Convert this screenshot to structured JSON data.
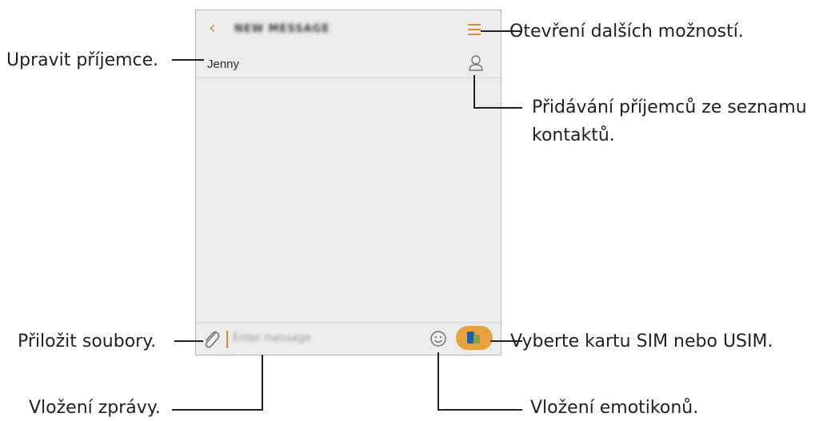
{
  "app_bar": {
    "back_icon": "chevron-left-icon",
    "title": "NEW MESSAGE",
    "menu_icon": "menu-icon"
  },
  "recipient": {
    "name": "Jenny",
    "contact_icon": "person-icon"
  },
  "compose": {
    "attach_icon": "paperclip-icon",
    "placeholder": "Enter message",
    "emoji_icon": "smiley-icon",
    "sim_icon": "sim-card-icon"
  },
  "callouts": {
    "more_options": "Otevření dalších možností.",
    "edit_recipients": "Upravit příjemce.",
    "add_from_contacts_line1": "Přidávání příjemců ze seznamu",
    "add_from_contacts_line2": "kontaktů.",
    "attach_files": "Přiložit soubory.",
    "select_sim": "Vyberte kartu SIM nebo USIM.",
    "insert_message": "Vložení zprávy.",
    "insert_emoticons": "Vložení emotikonů."
  },
  "colors": {
    "accent": "#e08a2c",
    "sim_button": "#e8a03b",
    "screen_bg": "#ececec",
    "text": "#231f20"
  }
}
